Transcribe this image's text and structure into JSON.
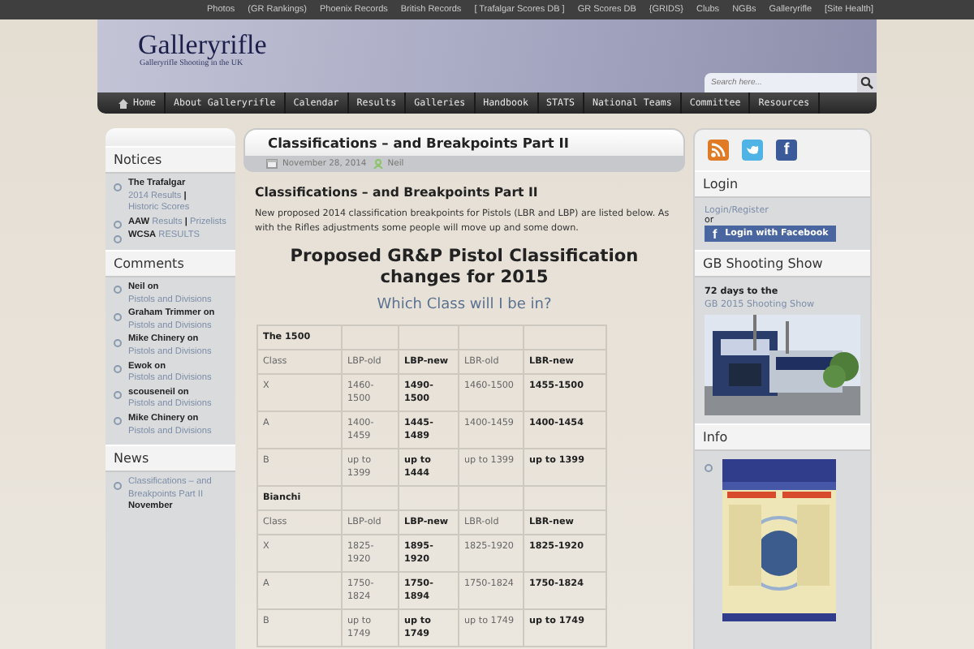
{
  "top_links": [
    "Photos",
    "(GR Rankings)",
    "Phoenix Records",
    "British Records",
    "[ Trafalgar Scores DB ]",
    "GR Scores DB",
    "{GRIDS}",
    "Clubs",
    "NGBs",
    "Galleryrifle",
    "[Site Health]"
  ],
  "site": {
    "title": "Galleryrifle",
    "tagline": "Galleryrifle Shooting in the UK"
  },
  "search": {
    "placeholder": "Search here..."
  },
  "nav": [
    {
      "label": "Home",
      "kind": "home"
    },
    {
      "label": "About Galleryrifle",
      "kind": "plain"
    },
    {
      "label": "Calendar",
      "kind": "plain"
    },
    {
      "label": "Results",
      "kind": "plain"
    },
    {
      "label": "Galleries",
      "kind": "plain"
    },
    {
      "label": "Handbook",
      "kind": "plain"
    },
    {
      "label": "STATS",
      "kind": "plain"
    },
    {
      "label": "National Teams",
      "kind": "plain"
    },
    {
      "label": "Committee",
      "kind": "plain"
    },
    {
      "label": "Resources",
      "kind": "plain"
    }
  ],
  "left_sidebar": [
    {
      "title": "Notices",
      "items": [
        [
          {
            "kind": "text",
            "text": "The Trafalgar"
          },
          {
            "kind": "link",
            "text": "2014 Results"
          },
          {
            "kind": "text",
            "text": "|"
          },
          {
            "kind": "link",
            "text": "Historic Scores"
          }
        ],
        [
          {
            "kind": "text",
            "text": "AAW"
          },
          {
            "kind": "link",
            "text": "Results"
          },
          {
            "kind": "text",
            "text": "|"
          },
          {
            "kind": "link",
            "text": "Prizelists"
          }
        ],
        [
          {
            "kind": "text",
            "text": "WCSA"
          },
          {
            "kind": "link",
            "text": "RESULTS"
          }
        ]
      ]
    },
    {
      "title": "Comments",
      "items": [
        [
          {
            "kind": "text",
            "text": "Neil on"
          },
          {
            "kind": "link",
            "text": "Pistols and Divisions"
          }
        ],
        [
          {
            "kind": "text",
            "text": "Graham Trimmer on"
          },
          {
            "kind": "link",
            "text": "Pistols and Divisions"
          }
        ],
        [
          {
            "kind": "text",
            "text": "Mike Chinery on"
          },
          {
            "kind": "link",
            "text": "Pistols and Divisions"
          }
        ],
        [
          {
            "kind": "text",
            "text": "Ewok on"
          },
          {
            "kind": "link",
            "text": "Pistols and Divisions"
          }
        ],
        [
          {
            "kind": "text",
            "text": "scouseneil on"
          },
          {
            "kind": "link",
            "text": "Pistols and Divisions"
          }
        ],
        [
          {
            "kind": "text",
            "text": "Mike Chinery on"
          },
          {
            "kind": "link",
            "text": "Pistols and Divisions"
          }
        ]
      ]
    },
    {
      "title": "News",
      "items": [
        [
          {
            "kind": "link",
            "text": "Classifications – and Breakpoints Part II"
          },
          {
            "kind": "text",
            "text": "November"
          }
        ]
      ]
    }
  ],
  "post": {
    "title": "Classifications – and Breakpoints Part II",
    "date": "November 28, 2014",
    "author": "Neil",
    "heading": "Classifications – and Breakpoints Part II",
    "intro": "New proposed 2014 classification breakpoints for Pistols (LBR and LBP) are listed below. As with the Rifles adjustments some people will move up and some down.",
    "subheading": "Proposed GR&P Pistol Classification changes for 2015",
    "question": "Which Class will I be in?",
    "table": [
      {
        "kind": "section",
        "cells": [
          "The 1500"
        ]
      },
      {
        "kind": "row",
        "cells": [
          "Class",
          "LBP-old",
          "LBP-new",
          "LBR-old",
          "LBR-new"
        ]
      },
      {
        "kind": "row",
        "cells": [
          "X",
          "1460-1500",
          "1490-1500",
          "1460-1500",
          "1455-1500"
        ]
      },
      {
        "kind": "row",
        "cells": [
          "A",
          "1400-1459",
          "1445-1489",
          "1400-1459",
          "1400-1454"
        ]
      },
      {
        "kind": "row",
        "cells": [
          "B",
          "up to 1399",
          "up to 1444",
          "up to 1399",
          "up to 1399"
        ]
      },
      {
        "kind": "section",
        "cells": [
          "Bianchi"
        ]
      },
      {
        "kind": "row",
        "cells": [
          "Class",
          "LBP-old",
          "LBP-new",
          "LBR-old",
          "LBR-new"
        ]
      },
      {
        "kind": "row",
        "cells": [
          "X",
          "1825-1920",
          "1895-1920",
          "1825-1920",
          "1825-1920"
        ]
      },
      {
        "kind": "row",
        "cells": [
          "A",
          "1750-1824",
          "1750-1894",
          "1750-1824",
          "1750-1824"
        ]
      },
      {
        "kind": "row",
        "cells": [
          "B",
          "up to 1749",
          "up to 1749",
          "up to 1749",
          "up to 1749"
        ]
      }
    ]
  },
  "right_sidebar": {
    "social": [
      {
        "kind": "rss"
      },
      {
        "kind": "twitter"
      },
      {
        "kind": "facebook",
        "icon": "f"
      }
    ],
    "login": {
      "title": "Login",
      "link": "Login/Register",
      "or": "or",
      "button": "Login with Facebook",
      "button_icon": "f"
    },
    "show": {
      "title": "GB Shooting Show",
      "text": "72 days to the",
      "link": "GB 2015 Shooting Show"
    },
    "info": {
      "title": "Info"
    }
  }
}
